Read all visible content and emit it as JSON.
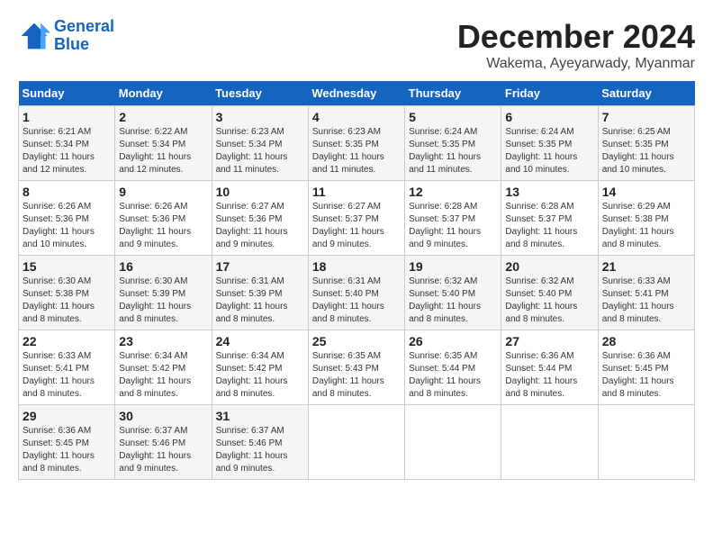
{
  "header": {
    "logo_line1": "General",
    "logo_line2": "Blue",
    "month": "December 2024",
    "location": "Wakema, Ayeyarwady, Myanmar"
  },
  "weekdays": [
    "Sunday",
    "Monday",
    "Tuesday",
    "Wednesday",
    "Thursday",
    "Friday",
    "Saturday"
  ],
  "weeks": [
    [
      {
        "day": "1",
        "sunrise": "Sunrise: 6:21 AM",
        "sunset": "Sunset: 5:34 PM",
        "daylight": "Daylight: 11 hours and 12 minutes."
      },
      {
        "day": "2",
        "sunrise": "Sunrise: 6:22 AM",
        "sunset": "Sunset: 5:34 PM",
        "daylight": "Daylight: 11 hours and 12 minutes."
      },
      {
        "day": "3",
        "sunrise": "Sunrise: 6:23 AM",
        "sunset": "Sunset: 5:34 PM",
        "daylight": "Daylight: 11 hours and 11 minutes."
      },
      {
        "day": "4",
        "sunrise": "Sunrise: 6:23 AM",
        "sunset": "Sunset: 5:35 PM",
        "daylight": "Daylight: 11 hours and 11 minutes."
      },
      {
        "day": "5",
        "sunrise": "Sunrise: 6:24 AM",
        "sunset": "Sunset: 5:35 PM",
        "daylight": "Daylight: 11 hours and 11 minutes."
      },
      {
        "day": "6",
        "sunrise": "Sunrise: 6:24 AM",
        "sunset": "Sunset: 5:35 PM",
        "daylight": "Daylight: 11 hours and 10 minutes."
      },
      {
        "day": "7",
        "sunrise": "Sunrise: 6:25 AM",
        "sunset": "Sunset: 5:35 PM",
        "daylight": "Daylight: 11 hours and 10 minutes."
      }
    ],
    [
      {
        "day": "8",
        "sunrise": "Sunrise: 6:26 AM",
        "sunset": "Sunset: 5:36 PM",
        "daylight": "Daylight: 11 hours and 10 minutes."
      },
      {
        "day": "9",
        "sunrise": "Sunrise: 6:26 AM",
        "sunset": "Sunset: 5:36 PM",
        "daylight": "Daylight: 11 hours and 9 minutes."
      },
      {
        "day": "10",
        "sunrise": "Sunrise: 6:27 AM",
        "sunset": "Sunset: 5:36 PM",
        "daylight": "Daylight: 11 hours and 9 minutes."
      },
      {
        "day": "11",
        "sunrise": "Sunrise: 6:27 AM",
        "sunset": "Sunset: 5:37 PM",
        "daylight": "Daylight: 11 hours and 9 minutes."
      },
      {
        "day": "12",
        "sunrise": "Sunrise: 6:28 AM",
        "sunset": "Sunset: 5:37 PM",
        "daylight": "Daylight: 11 hours and 9 minutes."
      },
      {
        "day": "13",
        "sunrise": "Sunrise: 6:28 AM",
        "sunset": "Sunset: 5:37 PM",
        "daylight": "Daylight: 11 hours and 8 minutes."
      },
      {
        "day": "14",
        "sunrise": "Sunrise: 6:29 AM",
        "sunset": "Sunset: 5:38 PM",
        "daylight": "Daylight: 11 hours and 8 minutes."
      }
    ],
    [
      {
        "day": "15",
        "sunrise": "Sunrise: 6:30 AM",
        "sunset": "Sunset: 5:38 PM",
        "daylight": "Daylight: 11 hours and 8 minutes."
      },
      {
        "day": "16",
        "sunrise": "Sunrise: 6:30 AM",
        "sunset": "Sunset: 5:39 PM",
        "daylight": "Daylight: 11 hours and 8 minutes."
      },
      {
        "day": "17",
        "sunrise": "Sunrise: 6:31 AM",
        "sunset": "Sunset: 5:39 PM",
        "daylight": "Daylight: 11 hours and 8 minutes."
      },
      {
        "day": "18",
        "sunrise": "Sunrise: 6:31 AM",
        "sunset": "Sunset: 5:40 PM",
        "daylight": "Daylight: 11 hours and 8 minutes."
      },
      {
        "day": "19",
        "sunrise": "Sunrise: 6:32 AM",
        "sunset": "Sunset: 5:40 PM",
        "daylight": "Daylight: 11 hours and 8 minutes."
      },
      {
        "day": "20",
        "sunrise": "Sunrise: 6:32 AM",
        "sunset": "Sunset: 5:40 PM",
        "daylight": "Daylight: 11 hours and 8 minutes."
      },
      {
        "day": "21",
        "sunrise": "Sunrise: 6:33 AM",
        "sunset": "Sunset: 5:41 PM",
        "daylight": "Daylight: 11 hours and 8 minutes."
      }
    ],
    [
      {
        "day": "22",
        "sunrise": "Sunrise: 6:33 AM",
        "sunset": "Sunset: 5:41 PM",
        "daylight": "Daylight: 11 hours and 8 minutes."
      },
      {
        "day": "23",
        "sunrise": "Sunrise: 6:34 AM",
        "sunset": "Sunset: 5:42 PM",
        "daylight": "Daylight: 11 hours and 8 minutes."
      },
      {
        "day": "24",
        "sunrise": "Sunrise: 6:34 AM",
        "sunset": "Sunset: 5:42 PM",
        "daylight": "Daylight: 11 hours and 8 minutes."
      },
      {
        "day": "25",
        "sunrise": "Sunrise: 6:35 AM",
        "sunset": "Sunset: 5:43 PM",
        "daylight": "Daylight: 11 hours and 8 minutes."
      },
      {
        "day": "26",
        "sunrise": "Sunrise: 6:35 AM",
        "sunset": "Sunset: 5:44 PM",
        "daylight": "Daylight: 11 hours and 8 minutes."
      },
      {
        "day": "27",
        "sunrise": "Sunrise: 6:36 AM",
        "sunset": "Sunset: 5:44 PM",
        "daylight": "Daylight: 11 hours and 8 minutes."
      },
      {
        "day": "28",
        "sunrise": "Sunrise: 6:36 AM",
        "sunset": "Sunset: 5:45 PM",
        "daylight": "Daylight: 11 hours and 8 minutes."
      }
    ],
    [
      {
        "day": "29",
        "sunrise": "Sunrise: 6:36 AM",
        "sunset": "Sunset: 5:45 PM",
        "daylight": "Daylight: 11 hours and 8 minutes."
      },
      {
        "day": "30",
        "sunrise": "Sunrise: 6:37 AM",
        "sunset": "Sunset: 5:46 PM",
        "daylight": "Daylight: 11 hours and 9 minutes."
      },
      {
        "day": "31",
        "sunrise": "Sunrise: 6:37 AM",
        "sunset": "Sunset: 5:46 PM",
        "daylight": "Daylight: 11 hours and 9 minutes."
      },
      null,
      null,
      null,
      null
    ]
  ]
}
